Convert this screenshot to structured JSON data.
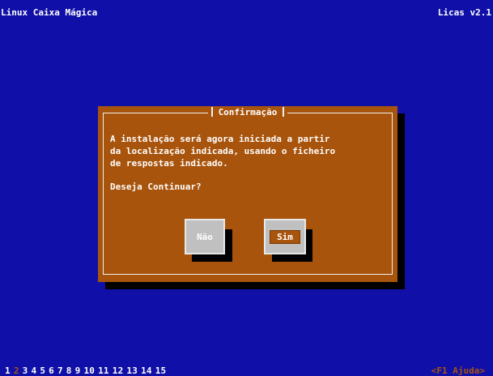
{
  "header": {
    "left_title": "Linux Caixa Mágica",
    "right_title": "Licas v2.1"
  },
  "dialog": {
    "title": "Confirmação",
    "message": [
      "A instalação será agora iniciada a partir",
      "da localização indicada, usando o ficheiro",
      "de respostas indicado."
    ],
    "question": "Deseja Continuar?",
    "buttons": {
      "no": "Não",
      "yes": "Sim"
    }
  },
  "footer": {
    "tabs": [
      "1",
      "2",
      "3",
      "4",
      "5",
      "6",
      "7",
      "8",
      "9",
      "10",
      "11",
      "12",
      "13",
      "14",
      "15"
    ],
    "current_tab": "2",
    "help": "<F1 Ajuda>"
  }
}
